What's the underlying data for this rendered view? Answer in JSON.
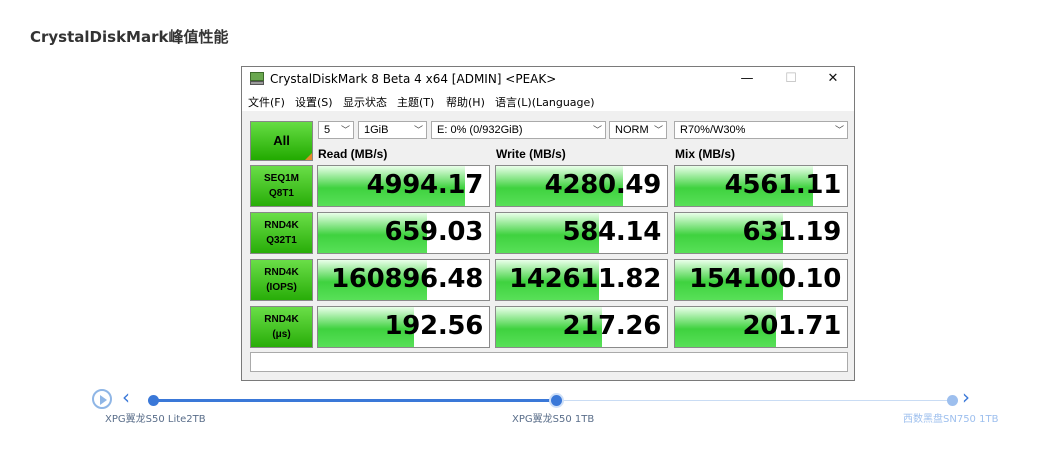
{
  "page": {
    "heading": "CrystalDiskMark峰值性能"
  },
  "window": {
    "title": "CrystalDiskMark 8 Beta 4 x64 [ADMIN] <PEAK>",
    "controls": {
      "minimize": "—",
      "maximize": "☐",
      "close": "✕"
    },
    "icon": "disk-drive-icon"
  },
  "menu": [
    "文件(F)",
    "设置(S)",
    "显示状态",
    "主题(T)",
    "帮助(H)",
    "语言(L)(Language)"
  ],
  "toolbar": {
    "all_label": "All",
    "count": "5",
    "size": "1GiB",
    "drive": "E: 0% (0/932GiB)",
    "mode": "NORM",
    "mix": "R70%/W30%"
  },
  "columns": [
    "Read (MB/s)",
    "Write (MB/s)",
    "Mix (MB/s)"
  ],
  "rows": [
    {
      "label1": "SEQ1M",
      "label2": "Q8T1",
      "values": [
        "4994.17",
        "4280.49",
        "4561.11"
      ],
      "fill": [
        0.86,
        0.74,
        0.8
      ]
    },
    {
      "label1": "RND4K",
      "label2": "Q32T1",
      "values": [
        "659.03",
        "584.14",
        "631.19"
      ],
      "fill": [
        0.64,
        0.6,
        0.63
      ]
    },
    {
      "label1": "RND4K",
      "label2": "(IOPS)",
      "values": [
        "160896.48",
        "142611.82",
        "154100.10"
      ],
      "fill": [
        0.64,
        0.6,
        0.63
      ]
    },
    {
      "label1": "RND4K",
      "label2": "(μs)",
      "values": [
        "192.56",
        "217.26",
        "201.71"
      ],
      "fill": [
        0.56,
        0.62,
        0.59
      ]
    }
  ],
  "timeline": {
    "items": [
      {
        "label": "XPG翼龙S50 Lite2TB",
        "color": "#5a6e8a"
      },
      {
        "label": "XPG翼龙S50 1TB",
        "color": "#5a6e8a"
      },
      {
        "label": "西数黑盘SN750 1TB",
        "color": "#9dbfee"
      }
    ],
    "prev_icon": "chevron-left-icon",
    "next_icon": "chevron-right-icon",
    "play_icon": "play-icon",
    "active_index": 1
  }
}
